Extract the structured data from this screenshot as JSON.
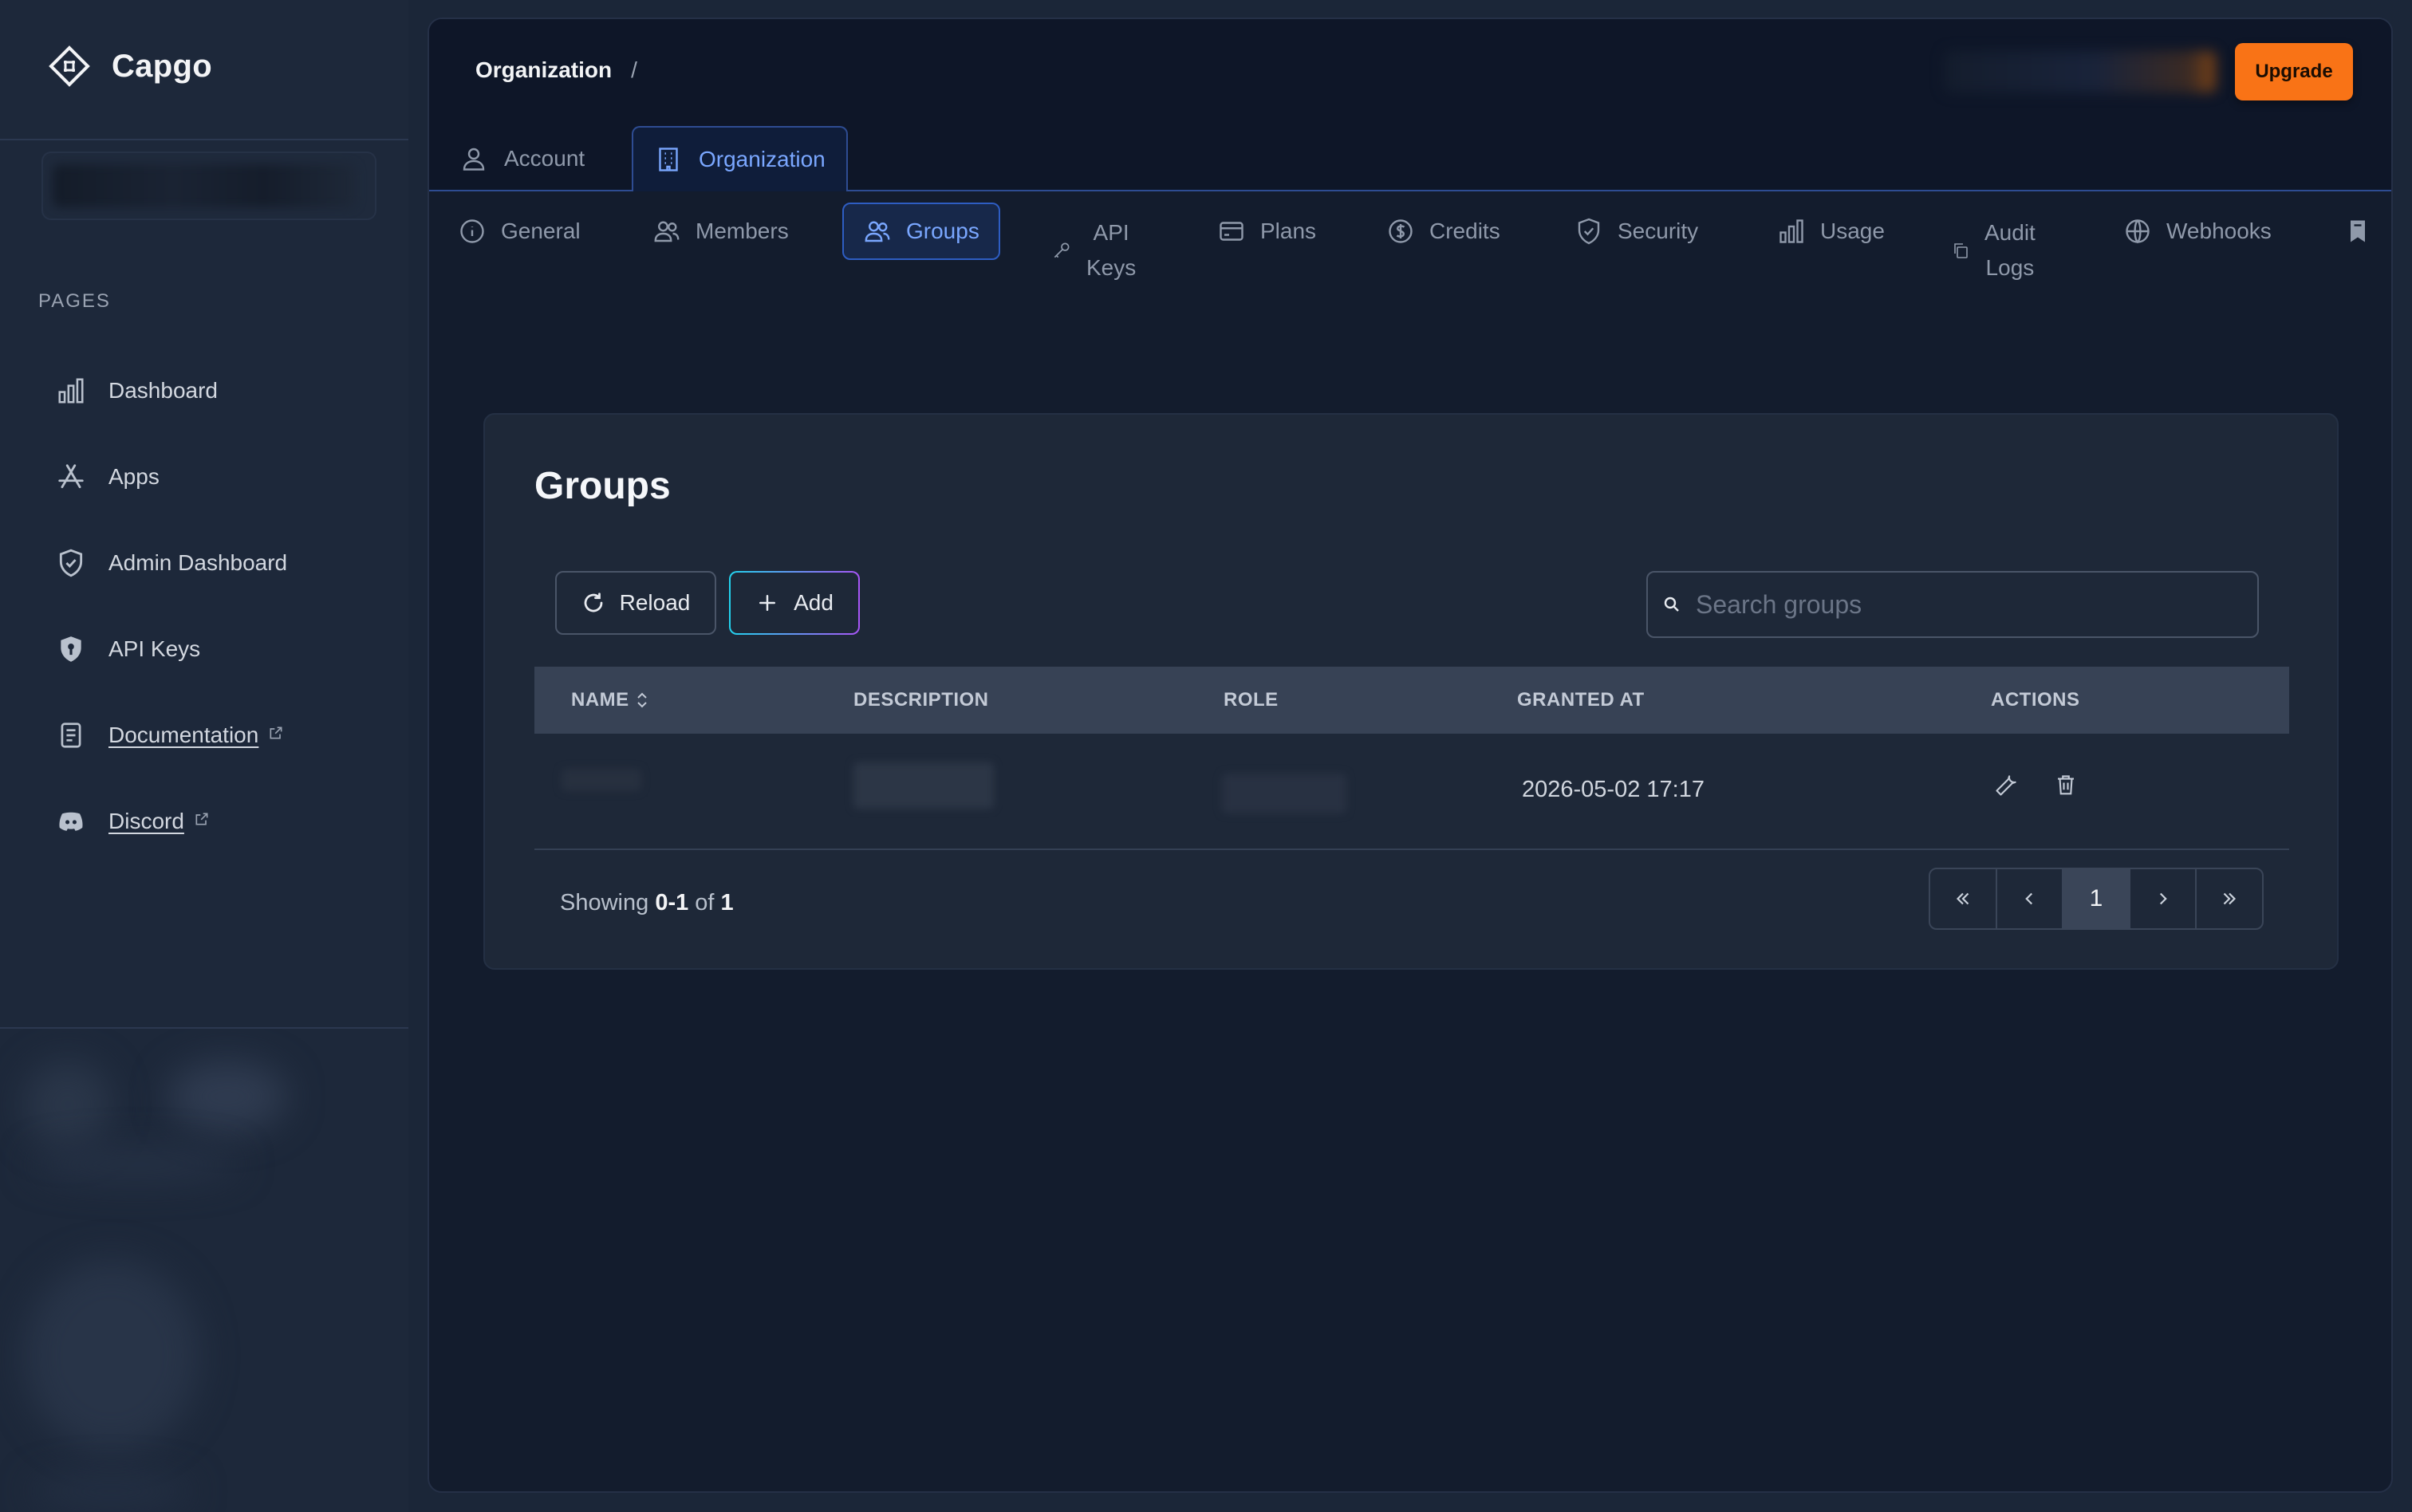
{
  "brand": {
    "name": "Capgo"
  },
  "sidebar": {
    "section_label": "PAGES",
    "items": [
      {
        "label": "Dashboard",
        "icon": "bar-chart-icon"
      },
      {
        "label": "Apps",
        "icon": "app-store-icon"
      },
      {
        "label": "Admin Dashboard",
        "icon": "shield-check-icon"
      },
      {
        "label": "API Keys",
        "icon": "shield-key-icon"
      },
      {
        "label": "Documentation",
        "icon": "document-icon",
        "external": true
      },
      {
        "label": "Discord",
        "icon": "discord-icon",
        "external": true
      }
    ]
  },
  "header": {
    "breadcrumb": "Organization",
    "breadcrumb_sep": "/",
    "upgrade_label": "Upgrade"
  },
  "top_tabs": [
    {
      "label": "Account",
      "icon": "user-icon",
      "active": false
    },
    {
      "label": "Organization",
      "icon": "building-icon",
      "active": true
    }
  ],
  "sub_tabs": [
    {
      "label": "General",
      "icon": "info-icon"
    },
    {
      "label": "Members",
      "icon": "users-icon"
    },
    {
      "label": "Groups",
      "icon": "users-icon",
      "active": true
    },
    {
      "label": "API\nKeys",
      "icon": "key-icon"
    },
    {
      "label": "Plans",
      "icon": "credit-card-icon"
    },
    {
      "label": "Credits",
      "icon": "dollar-circle-icon"
    },
    {
      "label": "Security",
      "icon": "shield-icon"
    },
    {
      "label": "Usage",
      "icon": "bar-chart-icon"
    },
    {
      "label": "Audit\nLogs",
      "icon": "copy-icon"
    },
    {
      "label": "Webhooks",
      "icon": "globe-icon"
    },
    {
      "label": "",
      "icon": "bookmark-icon"
    }
  ],
  "groups": {
    "title": "Groups",
    "reload_label": "Reload",
    "add_label": "Add",
    "search_placeholder": "Search groups",
    "columns": [
      "NAME",
      "DESCRIPTION",
      "ROLE",
      "GRANTED AT",
      "ACTIONS"
    ],
    "rows": [
      {
        "name": "",
        "description": "",
        "role": "",
        "granted_at": "2026-05-02 17:17"
      }
    ],
    "showing_prefix": "Showing",
    "showing_range": "0-1",
    "showing_of": "of",
    "showing_total": "1",
    "current_page": "1"
  },
  "colors": {
    "accent": "#7aa7ff",
    "upgrade": "#f97316",
    "background": "#131c2d"
  }
}
